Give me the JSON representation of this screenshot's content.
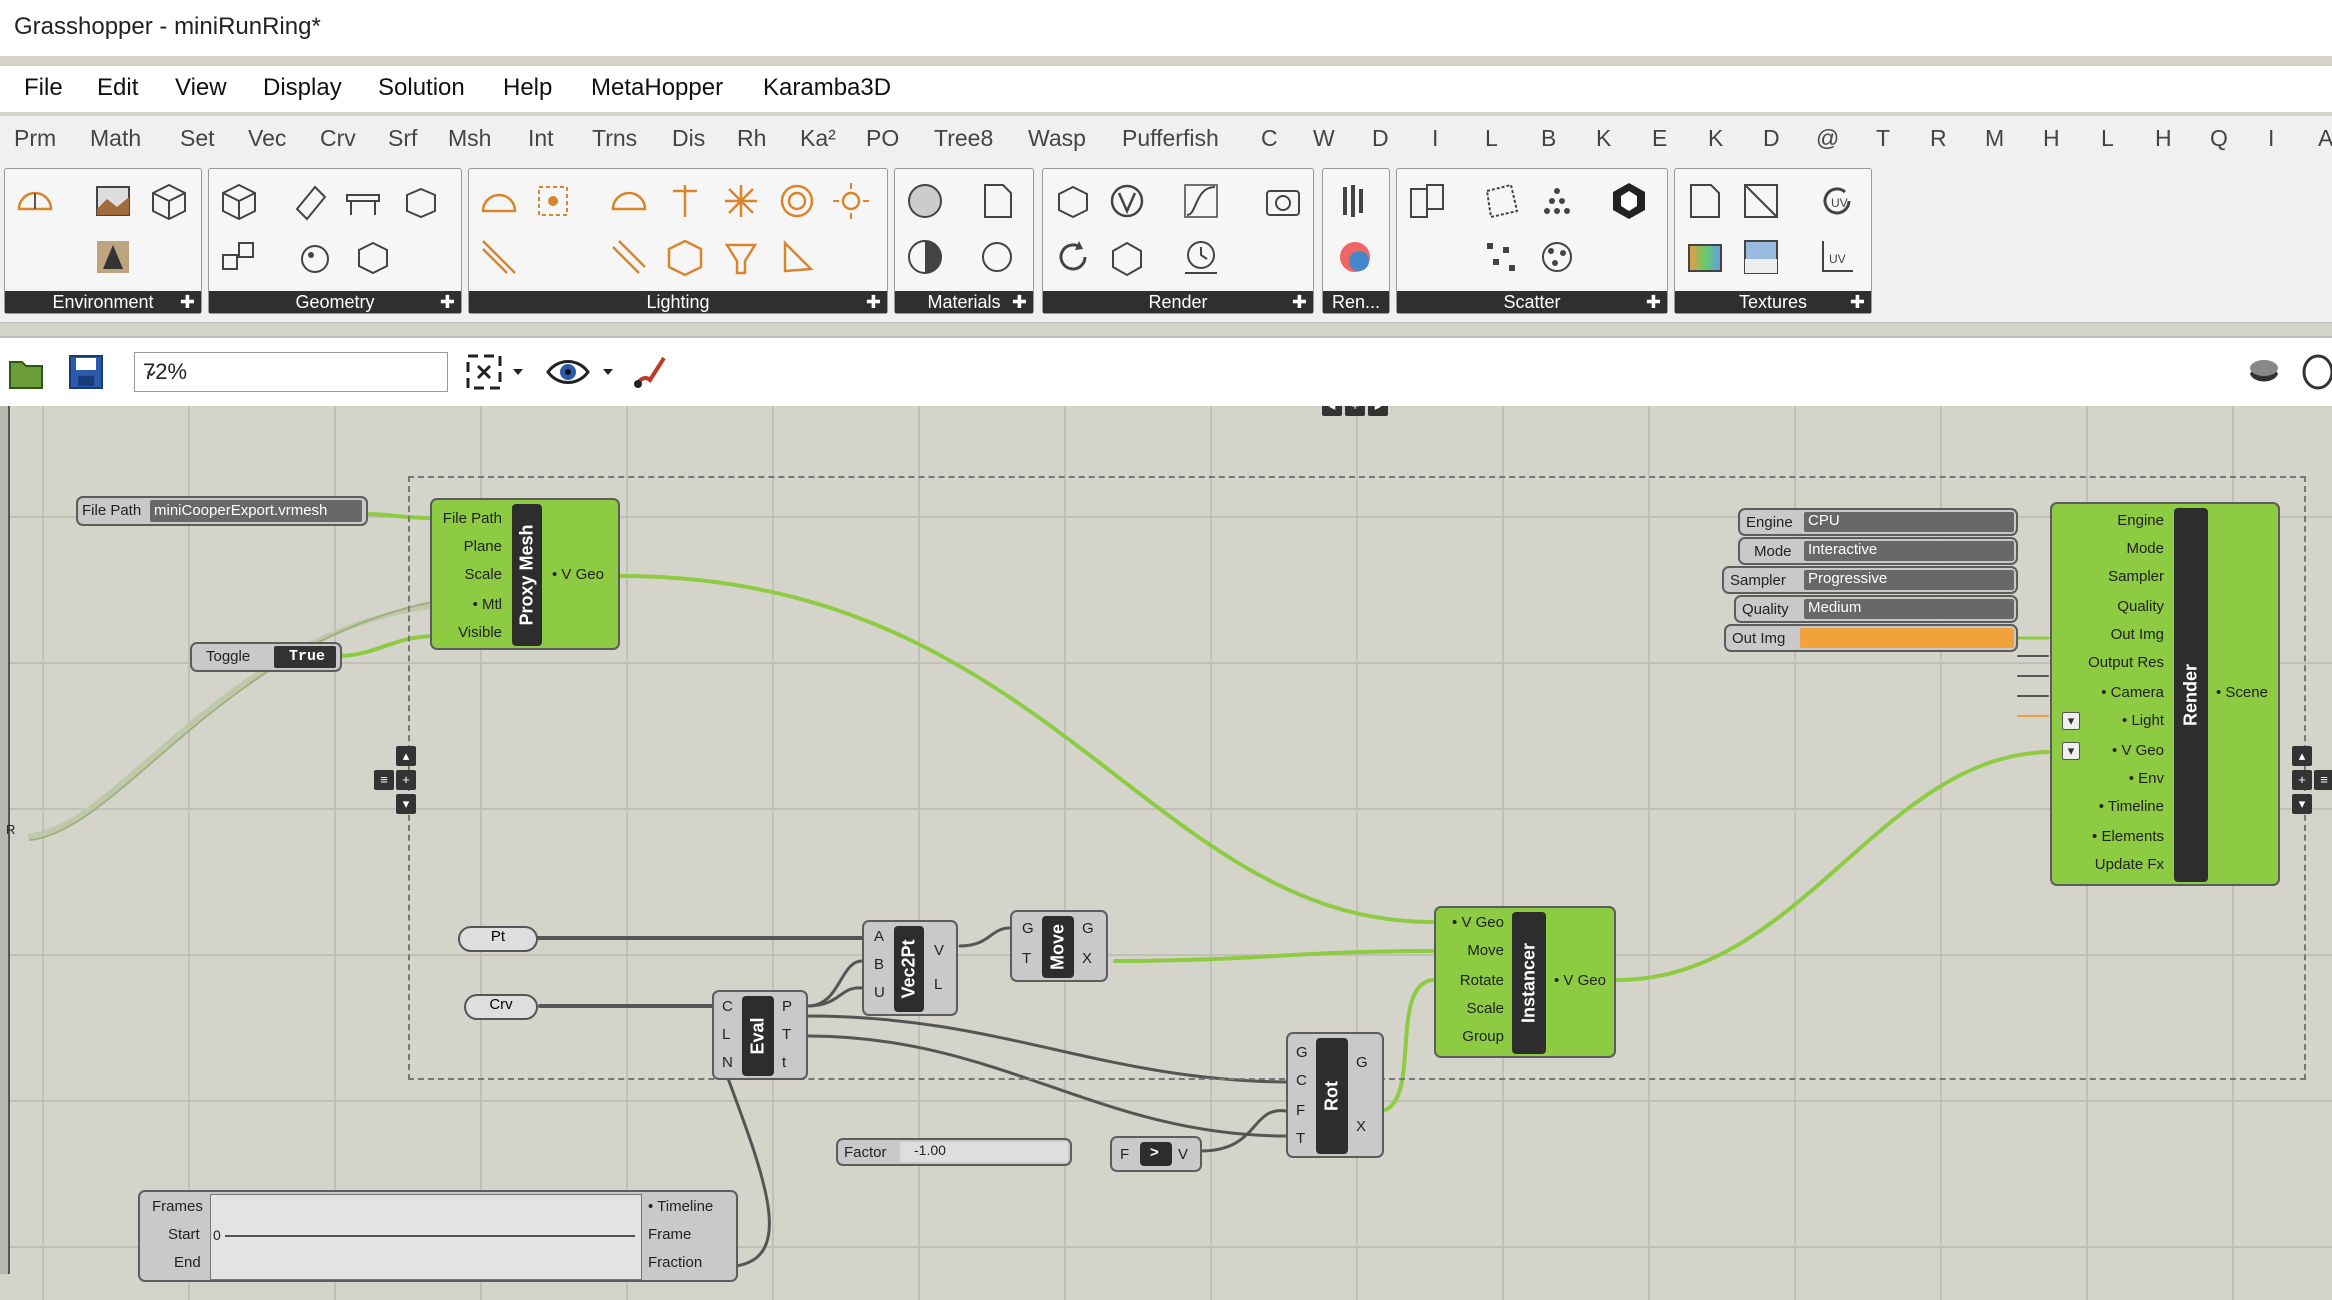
{
  "window": {
    "title": "Grasshopper - miniRunRing*"
  },
  "menu": [
    "File",
    "Edit",
    "View",
    "Display",
    "Solution",
    "Help",
    "MetaHopper",
    "Karamba3D"
  ],
  "tabs": [
    "Prm",
    "Math",
    "Set",
    "Vec",
    "Crv",
    "Srf",
    "Msh",
    "Int",
    "Trns",
    "Dis",
    "Rh",
    "Ka²",
    "PO",
    "Tree8",
    "Wasp",
    "Pufferfish",
    "C",
    "W",
    "D",
    "I",
    "L",
    "B",
    "K",
    "E",
    "K",
    "D",
    "@",
    "T",
    "R",
    "M",
    "H",
    "L",
    "H",
    "Q",
    "I",
    "A"
  ],
  "ribbon_panels": [
    "Environment",
    "Geometry",
    "Lighting",
    "Materials",
    "Render",
    "Ren...",
    "Scatter",
    "Textures"
  ],
  "toolbar": {
    "zoom": "72%"
  },
  "canvas": {
    "filepath": {
      "label": "File Path",
      "value": "miniCooperExport.vrmesh"
    },
    "toggle": {
      "label": "Toggle",
      "value": "True"
    },
    "proxy_mesh": {
      "name": "Proxy Mesh",
      "inputs": [
        "File Path",
        "Plane",
        "Scale",
        "• Mtl",
        "Visible"
      ],
      "output": "• V Geo"
    },
    "render": {
      "name": "Render",
      "inputs": [
        "Engine",
        "Mode",
        "Sampler",
        "Quality",
        "Out Img",
        "Output Res",
        "• Camera",
        "• Light",
        "• V Geo",
        "• Env",
        "• Timeline",
        "• Elements",
        "Update Fx"
      ],
      "output": "• Scene"
    },
    "value_lists": [
      {
        "label": "Engine",
        "value": "CPU"
      },
      {
        "label": "Mode",
        "value": "Interactive"
      },
      {
        "label": "Sampler",
        "value": "Progressive"
      },
      {
        "label": "Quality",
        "value": "Medium"
      },
      {
        "label": "Out Img",
        "value": ""
      }
    ],
    "pt": "Pt",
    "crv": "Crv",
    "vec2pt": {
      "name": "Vec2Pt",
      "inputs": [
        "A",
        "B",
        "U"
      ],
      "outputs": [
        "V",
        "L"
      ]
    },
    "move": {
      "name": "Move",
      "inputs": [
        "G",
        "T"
      ],
      "outputs": [
        "G",
        "X"
      ]
    },
    "eval": {
      "name": "Eval",
      "inputs": [
        "C",
        "L",
        "N"
      ],
      "outputs": [
        "P",
        "T",
        "t"
      ]
    },
    "instancer": {
      "name": "Instancer",
      "inputs": [
        "• V Geo",
        "Move",
        "Rotate",
        "Scale",
        "Group"
      ],
      "output": "• V Geo"
    },
    "rot": {
      "name": "Rot",
      "inputs": [
        "G",
        "C",
        "F",
        "T"
      ],
      "outputs": [
        "G",
        "X"
      ]
    },
    "factor": {
      "label": "Factor",
      "value": "-1.00"
    },
    "neg": {
      "input": "F",
      "output": "V"
    },
    "timeline": {
      "inputs": [
        "Frames",
        "Start",
        "End"
      ],
      "outputs": [
        "• Timeline",
        "Frame",
        "Fraction"
      ],
      "start_value": "0"
    },
    "edge_label": "R"
  },
  "colors": {
    "component": "#8ccb42",
    "wire": "#8ccb42",
    "wire_dark": "#555555",
    "accent": "#f2a23a"
  }
}
